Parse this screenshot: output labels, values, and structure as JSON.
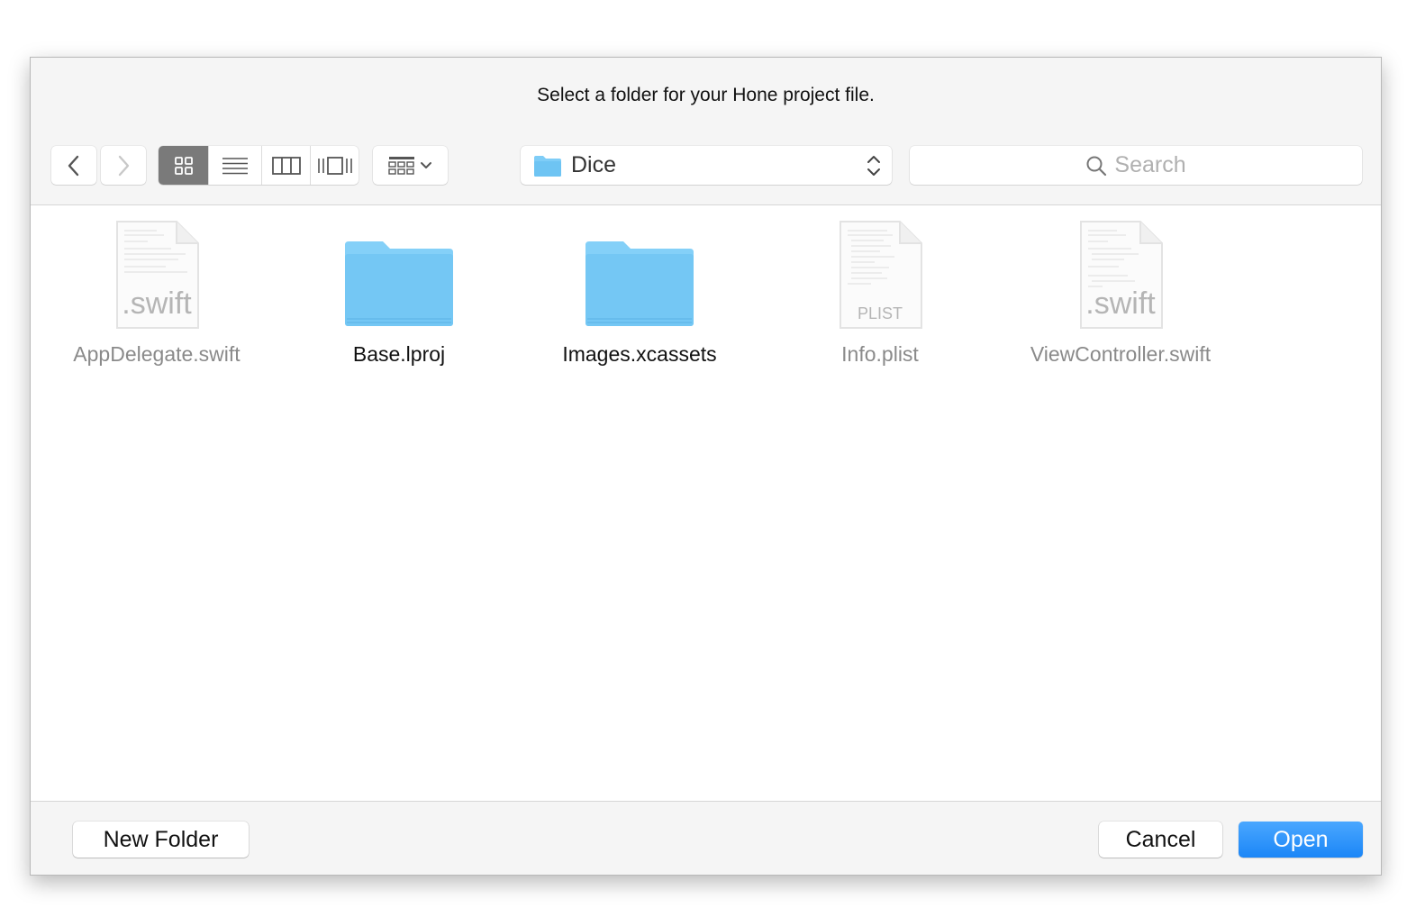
{
  "dialog": {
    "title": "Select a folder for your Hone project file."
  },
  "toolbar": {
    "back_icon": "chevron-left-icon",
    "forward_icon": "chevron-right-icon",
    "views": [
      {
        "icon": "icon-view-icon",
        "active": true
      },
      {
        "icon": "list-view-icon",
        "active": false
      },
      {
        "icon": "column-view-icon",
        "active": false
      },
      {
        "icon": "cover-flow-icon",
        "active": false
      }
    ],
    "arrange_icon": "arrange-grid-icon",
    "location": "Dice",
    "search_placeholder": "Search"
  },
  "files": [
    {
      "name": "AppDelegate.swift",
      "kind": "swift",
      "icon_label": ".swift",
      "enabled": false
    },
    {
      "name": "Base.lproj",
      "kind": "folder",
      "icon_label": "",
      "enabled": true
    },
    {
      "name": "Images.xcassets",
      "kind": "folder",
      "icon_label": "",
      "enabled": true
    },
    {
      "name": "Info.plist",
      "kind": "plist",
      "icon_label": "PLIST",
      "enabled": false
    },
    {
      "name": "ViewController.swift",
      "kind": "swift",
      "icon_label": ".swift",
      "enabled": false
    }
  ],
  "buttons": {
    "new_folder": "New Folder",
    "cancel": "Cancel",
    "open": "Open"
  },
  "colors": {
    "accent": "#1b86f7",
    "folder": "#7fcdf7"
  }
}
